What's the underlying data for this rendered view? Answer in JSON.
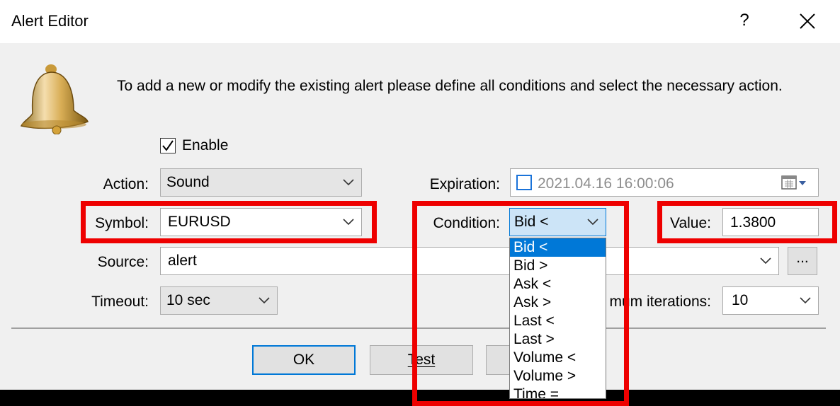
{
  "window": {
    "title": "Alert Editor",
    "help_glyph": "?",
    "close_icon": "close-icon"
  },
  "info_text": "To add a new or modify the existing alert please define all conditions and select the necessary action.",
  "enable": {
    "label": "Enable",
    "checked": true
  },
  "action": {
    "label": "Action:",
    "value": "Sound"
  },
  "expiration": {
    "label": "Expiration:",
    "value": "2021.04.16 16:00:06",
    "checked": false
  },
  "symbol": {
    "label": "Symbol:",
    "value": "EURUSD"
  },
  "condition": {
    "label": "Condition:",
    "value": "Bid <",
    "options": [
      "Bid <",
      "Bid >",
      "Ask <",
      "Ask >",
      "Last <",
      "Last >",
      "Volume <",
      "Volume >",
      "Time ="
    ]
  },
  "value": {
    "label": "Value:",
    "value": "1.3800"
  },
  "source": {
    "label": "Source:",
    "value": "alert",
    "browse_label": "..."
  },
  "timeout": {
    "label": "Timeout:",
    "value": "10 sec"
  },
  "max_iterations": {
    "label_visible": "mum iterations:",
    "value": "10"
  },
  "buttons": {
    "ok": "OK",
    "test": "Test"
  },
  "colors": {
    "highlight": "#ee0000",
    "selection": "#0078d7",
    "dialog_bg": "#f0f0f0"
  }
}
